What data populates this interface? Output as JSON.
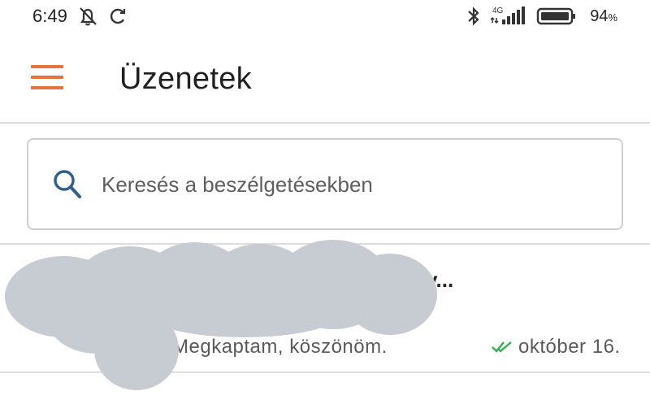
{
  "status_bar": {
    "time": "6:49",
    "network": "4G",
    "battery_percent": "94",
    "battery_unit": "%"
  },
  "header": {
    "title": "Üzenetek",
    "menu_icon": "hamburger-menu-icon",
    "accent_color": "#e8733a"
  },
  "search": {
    "placeholder": "Keresés a beszélgetésekben",
    "icon": "search-icon"
  },
  "conversations": [
    {
      "title_visible": "v...",
      "preview": "Megkaptam, köszönöm.",
      "date": "október 16.",
      "status_icon": "double-check-icon",
      "status_color": "#2fb14f"
    }
  ]
}
